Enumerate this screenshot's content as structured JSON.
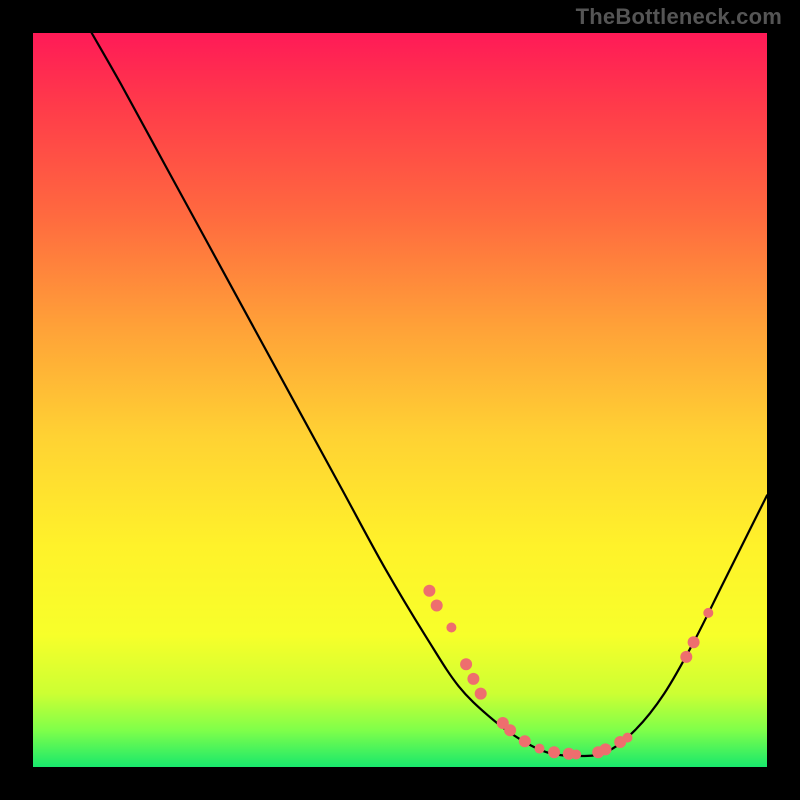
{
  "watermark": "TheBottleneck.com",
  "colors": {
    "background": "#000000",
    "gradient_top": "#ff1a57",
    "gradient_mid": "#ffd233",
    "gradient_bottom": "#18e86c",
    "curve": "#000000",
    "marker": "#ee6e6e"
  },
  "chart_data": {
    "type": "line",
    "title": "",
    "xlabel": "",
    "ylabel": "",
    "xlim": [
      0,
      100
    ],
    "ylim": [
      0,
      100
    ],
    "grid": false,
    "series": [
      {
        "name": "curve",
        "x": [
          8,
          12,
          18,
          24,
          30,
          36,
          42,
          48,
          54,
          58,
          62,
          66,
          70,
          74,
          78,
          82,
          86,
          90,
          94,
          98,
          100
        ],
        "y": [
          100,
          93,
          82,
          71,
          60,
          49,
          38,
          27,
          17,
          11,
          7,
          4,
          2,
          1.5,
          2,
          5,
          10,
          17,
          25,
          33,
          37
        ]
      }
    ],
    "markers": [
      {
        "x": 54,
        "y": 24,
        "r": 6
      },
      {
        "x": 55,
        "y": 22,
        "r": 6
      },
      {
        "x": 57,
        "y": 19,
        "r": 5
      },
      {
        "x": 59,
        "y": 14,
        "r": 6
      },
      {
        "x": 60,
        "y": 12,
        "r": 6
      },
      {
        "x": 61,
        "y": 10,
        "r": 6
      },
      {
        "x": 64,
        "y": 6,
        "r": 6
      },
      {
        "x": 65,
        "y": 5,
        "r": 6
      },
      {
        "x": 67,
        "y": 3.5,
        "r": 6
      },
      {
        "x": 69,
        "y": 2.5,
        "r": 5
      },
      {
        "x": 71,
        "y": 2,
        "r": 6
      },
      {
        "x": 73,
        "y": 1.8,
        "r": 6
      },
      {
        "x": 74,
        "y": 1.7,
        "r": 5
      },
      {
        "x": 77,
        "y": 2,
        "r": 6
      },
      {
        "x": 78,
        "y": 2.4,
        "r": 6
      },
      {
        "x": 80,
        "y": 3.4,
        "r": 6
      },
      {
        "x": 81,
        "y": 4,
        "r": 5
      },
      {
        "x": 89,
        "y": 15,
        "r": 6
      },
      {
        "x": 90,
        "y": 17,
        "r": 6
      },
      {
        "x": 92,
        "y": 21,
        "r": 5
      }
    ]
  }
}
